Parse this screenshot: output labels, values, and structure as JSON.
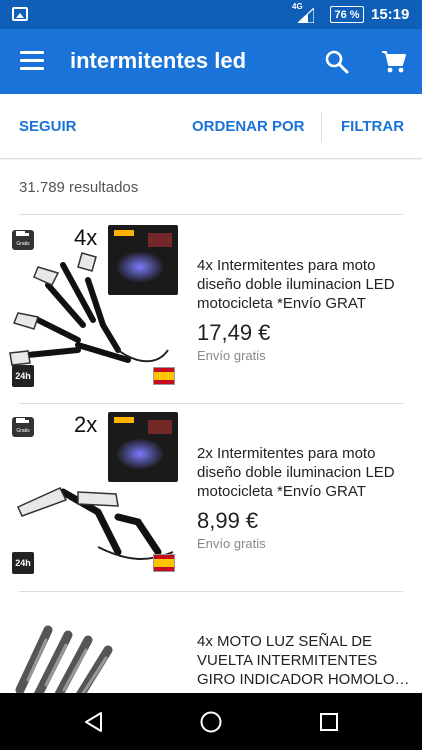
{
  "status": {
    "network": "4G",
    "battery": "76 %",
    "time": "15:19"
  },
  "appbar": {
    "title": "intermitentes led"
  },
  "actions": {
    "follow": "SEGUIR",
    "sort": "ORDENAR POR",
    "filter": "FILTRAR"
  },
  "results": {
    "count": "31.789 resultados"
  },
  "items": [
    {
      "title": "4x Intermitentes para moto diseño doble iluminacion LED motocicleta  *Envío GRAT",
      "price": "17,49 €",
      "shipping": "Envío gratis",
      "qty_label": "4x",
      "badge": "Gratis",
      "fast": "24h"
    },
    {
      "title": "2x Intermitentes para moto diseño doble iluminacion LED motocicleta  *Envío GRAT",
      "price": "8,99 €",
      "shipping": "Envío gratis",
      "qty_label": "2x",
      "badge": "Gratis",
      "fast": "24h"
    },
    {
      "title": "4x MOTO LUZ SEÑAL DE VUELTA INTERMITENTES GIRO INDICADOR HOMOLO…"
    }
  ],
  "colors": {
    "primary": "#1a73d8",
    "status_bar": "#0f5fb8"
  }
}
